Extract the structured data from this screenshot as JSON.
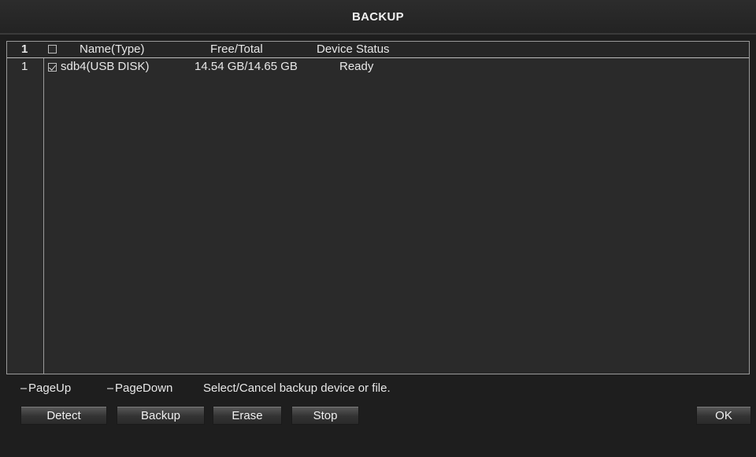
{
  "window": {
    "title": "BACKUP"
  },
  "table": {
    "header": {
      "index": "1",
      "name": "Name(Type)",
      "free_total": "Free/Total",
      "status": "Device Status"
    },
    "rows": [
      {
        "index": "1",
        "checked": true,
        "name": "sdb4(USB DISK)",
        "free_total": "14.54 GB/14.65 GB",
        "status": "Ready"
      }
    ]
  },
  "footer": {
    "page_up": "PageUp",
    "page_down": "PageDown",
    "hint": "Select/Cancel backup device or file."
  },
  "buttons": {
    "detect": "Detect",
    "backup": "Backup",
    "erase": "Erase",
    "stop": "Stop",
    "ok": "OK"
  }
}
